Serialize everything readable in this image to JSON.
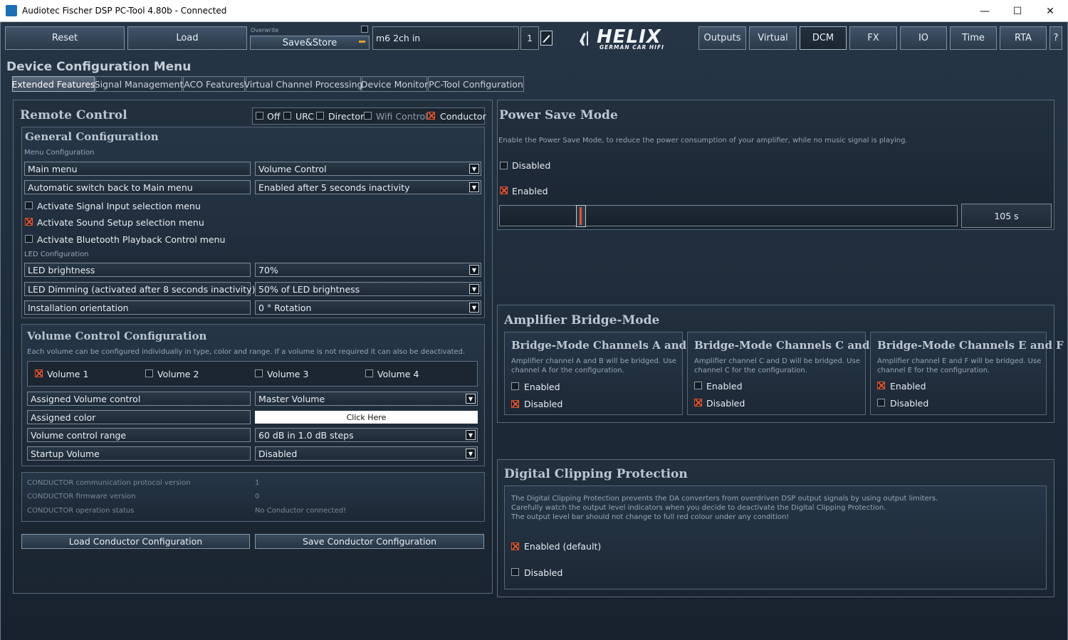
{
  "window": {
    "title": "Audiotec Fischer DSP PC-Tool 4.80b - Connected",
    "minimize": "—",
    "maximize": "☐",
    "close": "✕"
  },
  "toolbar": {
    "reset": "Reset",
    "load": "Load",
    "overwrite_label": "Overwrite",
    "save_store": "Save&Store",
    "preset_name": "m6 2ch in",
    "preset_number": "1",
    "logo_text": "HELIX",
    "logo_sub": "GERMAN CAR HIFI",
    "nav": [
      "Outputs",
      "Virtual",
      "DCM",
      "FX",
      "IO",
      "Time",
      "RTA",
      "?"
    ],
    "active_nav": "DCM"
  },
  "page": {
    "title": "Device Configuration Menu",
    "tabs": [
      "Extended Features",
      "Signal Management",
      "ACO Features",
      "Virtual Channel Processing",
      "Device Monitor",
      "PC-Tool Configuration"
    ],
    "active_tab": "Extended Features"
  },
  "remote": {
    "title": "Remote Control",
    "modes": [
      {
        "label": "Off",
        "checked": false
      },
      {
        "label": "URC",
        "checked": false
      },
      {
        "label": "Director",
        "checked": false
      },
      {
        "label": "Wifi Control",
        "checked": false
      },
      {
        "label": "Conductor",
        "checked": true
      }
    ],
    "general": {
      "title": "General Configuration",
      "menu_section": "Menu Configuration",
      "main_menu_label": "Main menu",
      "main_menu_value": "Volume Control",
      "auto_switch_label": "Automatic switch back to Main menu",
      "auto_switch_value": "Enabled after 5 seconds inactivity",
      "opt_signal_input": "Activate Signal Input selection menu",
      "opt_sound_setup": "Activate Sound Setup selection menu",
      "opt_bluetooth": "Activate Bluetooth Playback Control menu",
      "opt_signal_checked": false,
      "opt_sound_checked": true,
      "opt_bt_checked": false,
      "led_section": "LED Configuration",
      "led_brightness_label": "LED brightness",
      "led_brightness_value": "70%",
      "led_dimming_label": "LED Dimming (activated after 8 seconds inactivity)",
      "led_dimming_value": "50% of LED brightness",
      "orientation_label": "Installation orientation",
      "orientation_value": "0 ° Rotation"
    },
    "volume": {
      "title": "Volume Control Configuration",
      "desc": "Each volume can be configured individually in type, color and range. If a volume is not required it can also be deactivated.",
      "volumes": [
        {
          "label": "Volume 1",
          "checked": true
        },
        {
          "label": "Volume 2",
          "checked": false
        },
        {
          "label": "Volume 3",
          "checked": false
        },
        {
          "label": "Volume 4",
          "checked": false
        }
      ],
      "assigned_control_label": "Assigned Volume control",
      "assigned_control_value": "Master Volume",
      "assigned_color_label": "Assigned color",
      "assigned_color_button": "Click Here",
      "range_label": "Volume control range",
      "range_value": "60 dB in 1.0 dB steps",
      "startup_label": "Startup Volume",
      "startup_value": "Disabled"
    },
    "info": {
      "protocol_label": "CONDUCTOR communication protocol version",
      "protocol_value": "1",
      "firmware_label": "CONDUCTOR firmware version",
      "firmware_value": "0",
      "status_label": "CONDUCTOR operation status",
      "status_value": "No Conductor connected!"
    },
    "load_btn": "Load Conductor Configuration",
    "save_btn": "Save Conductor Configuration"
  },
  "power_save": {
    "title": "Power Save Mode",
    "desc": "Enable the Power Save Mode, to reduce the power consumption of your amplifier, while no music signal is playing.",
    "disabled_label": "Disabled",
    "enabled_label": "Enabled",
    "enabled_checked": true,
    "delay_value": "105 s",
    "slider_fraction": 0.17
  },
  "bridge": {
    "title": "Amplifier Bridge-Mode",
    "groups": [
      {
        "title": "Bridge-Mode Channels A and B",
        "desc": "Amplifier channel A and B will be bridged. Use channel A for the configuration.",
        "enabled": "Enabled",
        "disabled": "Disabled",
        "state": "disabled"
      },
      {
        "title": "Bridge-Mode Channels C and D",
        "desc": "Amplifier channel C and D will be bridged. Use channel C for the configuration.",
        "enabled": "Enabled",
        "disabled": "Disabled",
        "state": "disabled"
      },
      {
        "title": "Bridge-Mode Channels E and F",
        "desc": "Amplifier channel E and F will be bridged. Use channel E for the configuration.",
        "enabled": "Enabled",
        "disabled": "Disabled",
        "state": "enabled"
      }
    ]
  },
  "clipping": {
    "title": "Digital Clipping Protection",
    "desc1": "The Digital Clipping Protection prevents the DA converters from overdriven DSP output signals by using output limiters.",
    "desc2": "Carefully watch the output level indicators when you decide to deactivate the Digital Clipping Protection.",
    "desc3": "The output level bar should not change to full red colour under any condition!",
    "enabled_label": "Enabled (default)",
    "disabled_label": "Disabled",
    "enabled_checked": true
  },
  "colors": {
    "accent": "#e4572e",
    "bg": "#1d2a38"
  }
}
